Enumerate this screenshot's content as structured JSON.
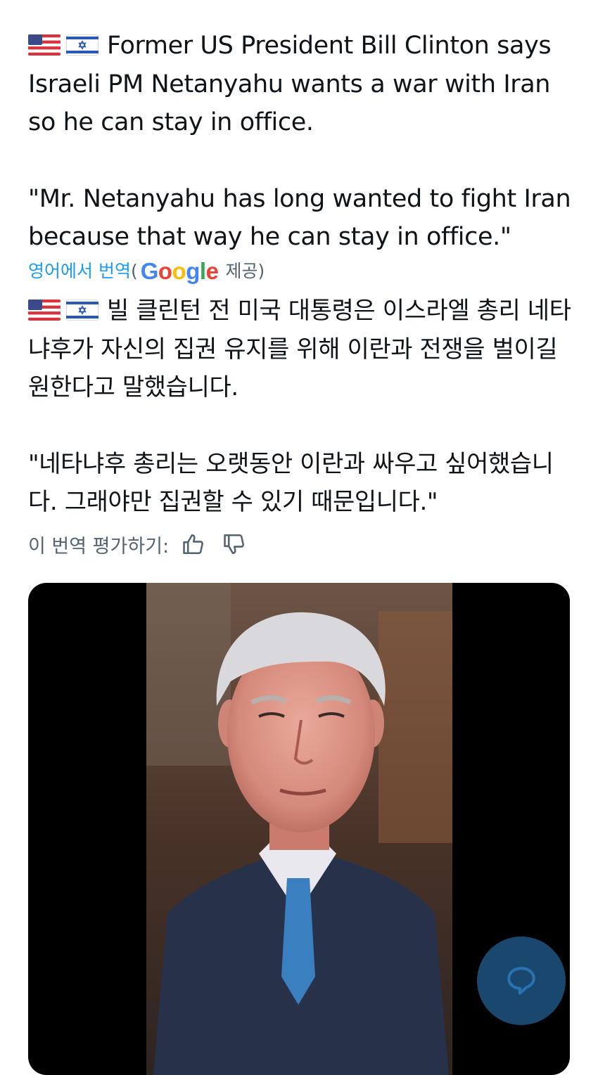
{
  "tweet": {
    "flags": [
      "us-flag-icon",
      "israel-flag-icon"
    ],
    "original_line1": "Former US President Bill Clinton says Israeli PM Netanyahu wants a war with Iran so he can stay in office.",
    "original_quote": "\"Mr. Netanyahu has long wanted to fight Iran because that way he can stay in office.\"",
    "translation_link": "영어에서 번역",
    "translation_open": "(",
    "translation_provider": "Google",
    "translation_suffix": "제공)",
    "translated_line1": "빌 클린턴 전 미국 대통령은 이스라엘 총리 네타냐후가 자신의 집권 유지를 위해 이란과 전쟁을 벌이길 원한다고 말했습니다.",
    "translated_quote": "\"네타냐후 총리는 오랫동안 이란과 싸우고 싶어했습니다. 그래야만 집권할 수 있기 때문입니다.\"",
    "rate_label": "이 번역 평가하기:"
  },
  "colors": {
    "text": "#0f1419",
    "secondary": "#536471",
    "link": "#1d9bf0",
    "fab": "#1d4f7a"
  },
  "icons": {
    "thumb_up": "thumbs-up-icon",
    "thumb_down": "thumbs-down-icon",
    "reply": "reply-bubble-icon"
  }
}
